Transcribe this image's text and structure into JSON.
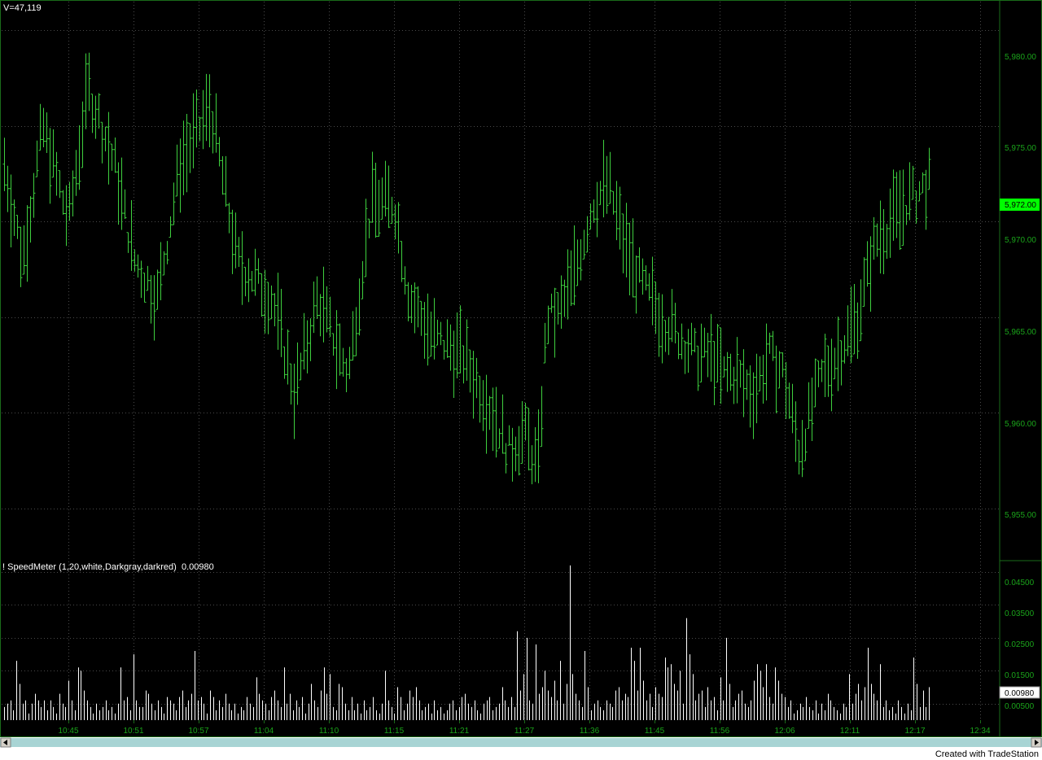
{
  "volume_label": "V=47,119",
  "footer_text": "Created with TradeStation",
  "colors": {
    "background": "#000000",
    "price_bars": "#3ecf3e",
    "speed_bars": "#ffffff",
    "grid": "#4a4a4a",
    "axis_text": "#1aa31a",
    "last_price_bg": "#00ff00",
    "scrollbar": "#a8d4d4"
  },
  "chart_data": [
    {
      "type": "ohlc",
      "title": "",
      "y_ticks": [
        "5,980.00",
        "5,975.00",
        "5,970.00",
        "5,965.00",
        "5,960.00",
        "5,955.00"
      ],
      "y_tick_values": [
        5980,
        5975,
        5970,
        5965,
        5960,
        5955
      ],
      "ylim": [
        5952.3,
        5981.5
      ],
      "last_price": 5972.0,
      "last_price_label": "5,972.00",
      "grid": true,
      "bar_count": 285,
      "path_times": [
        0,
        12,
        25,
        42,
        55,
        72,
        85,
        100,
        115,
        135,
        152,
        175,
        190,
        205,
        225,
        240,
        255,
        265,
        280
      ],
      "path_values": [
        5973,
        5968,
        5975,
        5970,
        5977,
        5973,
        5968,
        5966,
        5973,
        5976,
        5968,
        5966,
        5961,
        5966,
        5962,
        5971,
        5971,
        5966,
        5964
      ],
      "path_times_2": [
        300,
        320,
        330,
        340,
        349
      ],
      "path_values_2": [
        5963,
        5960,
        5958,
        5959,
        5957
      ],
      "path_times_3": [
        355,
        362,
        372,
        385,
        395,
        405,
        415,
        430,
        442,
        452,
        462,
        470,
        478,
        490,
        500,
        510,
        520,
        535,
        545,
        558,
        570,
        590,
        605
      ],
      "path_values_3": [
        5965,
        5965,
        5967,
        5971,
        5972,
        5969,
        5967,
        5965,
        5964,
        5963,
        5963,
        5962,
        5962,
        5961,
        5963,
        5962,
        5958,
        5962,
        5963,
        5965,
        5969,
        5971,
        5972
      ],
      "x_ticks": [
        "10:45",
        "10:51",
        "10:57",
        "11:04",
        "11:10",
        "11:15",
        "11:21",
        "11:27",
        "11:36",
        "11:45",
        "11:56",
        "12:06",
        "12:11",
        "12:17",
        "12:34"
      ]
    },
    {
      "type": "bar",
      "title": "! SpeedMeter (1,20,white,Darkgray,darkred)",
      "current_value": "0.00980",
      "y_ticks": [
        "0.04500",
        "0.03500",
        "0.02500",
        "0.01500",
        "0.00500"
      ],
      "y_tick_values": [
        0.045,
        0.035,
        0.025,
        0.015,
        0.005
      ],
      "ylim": [
        0,
        0.0482
      ],
      "grid": true,
      "series": [
        {
          "values": [
            0.004,
            0.005,
            0.006,
            0.003,
            0.018,
            0.011,
            0.005,
            0.006,
            0.002,
            0.005,
            0.008,
            0.006,
            0.004,
            0.006,
            0.003,
            0.006,
            0.004,
            0.002,
            0.008,
            0.005,
            0.004,
            0.012,
            0.006,
            0.003,
            0.016,
            0.015,
            0.009,
            0.006,
            0.004,
            0.002,
            0.005,
            0.003,
            0.004,
            0.006,
            0.003,
            0.004,
            0.002,
            0.005,
            0.016,
            0.006,
            0.007,
            0.003,
            0.02,
            0.006,
            0.004,
            0.004,
            0.009,
            0.008,
            0.005,
            0.003,
            0.006,
            0.004,
            0.002,
            0.007,
            0.006,
            0.005,
            0.003,
            0.007,
            0.009,
            0.004,
            0.006,
            0.008,
            0.021,
            0.006,
            0.007,
            0.005,
            0.002,
            0.009,
            0.007,
            0.003,
            0.006,
            0.004,
            0.008,
            0.005,
            0.003,
            0.005,
            0.002,
            0.004,
            0.003,
            0.007,
            0.005,
            0.004,
            0.013,
            0.008,
            0.006,
            0.005,
            0.003,
            0.007,
            0.009,
            0.006,
            0.004,
            0.016,
            0.005,
            0.008,
            0.003,
            0.006,
            0.004,
            0.007,
            0.002,
            0.005,
            0.011,
            0.006,
            0.004,
            0.009,
            0.016,
            0.008,
            0.014,
            0.004,
            0.003,
            0.011,
            0.01,
            0.005,
            0.003,
            0.007,
            0.003,
            0.005,
            0.002,
            0.006,
            0.003,
            0.004,
            0.007,
            0.003,
            0.002,
            0.005,
            0.015,
            0.006,
            0.004,
            0.002,
            0.01,
            0.007,
            0.003,
            0.005,
            0.009,
            0.007,
            0.01,
            0.006,
            0.003,
            0.004,
            0.005,
            0.002,
            0.006,
            0.003,
            0.004,
            0.002,
            0.003,
            0.005,
            0.006,
            0.003,
            0.004,
            0.007,
            0.008,
            0.005,
            0.004,
            0.006,
            0.003,
            0.002,
            0.005,
            0.006,
            0.007,
            0.003,
            0.004,
            0.005,
            0.01,
            0.006,
            0.004,
            0.007,
            0.004,
            0.027,
            0.009,
            0.014,
            0.025,
            0.006,
            0.005,
            0.023,
            0.008,
            0.01,
            0.015,
            0.009,
            0.007,
            0.012,
            0.006,
            0.018,
            0.005,
            0.011,
            0.047,
            0.014,
            0.008,
            0.006,
            0.004,
            0.021,
            0.01,
            0.003,
            0.005,
            0.006,
            0.004,
            0.003,
            0.006,
            0.005,
            0.004,
            0.009,
            0.01,
            0.006,
            0.008,
            0.007,
            0.022,
            0.018,
            0.009,
            0.022,
            0.012,
            0.006,
            0.008,
            0.004,
            0.01,
            0.008,
            0.007,
            0.019,
            0.016,
            0.017,
            0.011,
            0.009,
            0.015,
            0.005,
            0.031,
            0.02,
            0.014,
            0.006,
            0.008,
            0.009,
            0.004,
            0.01,
            0.006,
            0.007,
            0.003,
            0.013,
            0.006,
            0.025,
            0.011,
            0.004,
            0.006,
            0.008,
            0.009,
            0.005,
            0.004,
            0.006,
            0.012,
            0.017,
            0.015,
            0.01,
            0.017,
            0.007,
            0.005,
            0.016,
            0.012,
            0.008,
            0.007,
            0.004,
            0.006,
            0.002,
            0.003,
            0.005,
            0.004,
            0.007,
            0.004,
            0.003,
            0.006,
            0.002,
            0.005,
            0.003,
            0.008,
            0.006,
            0.004,
            0.003,
            0.002,
            0.005,
            0.004,
            0.014,
            0.005,
            0.008,
            0.011,
            0.006,
            0.01,
            0.022,
            0.011,
            0.008,
            0.006,
            0.017,
            0.004,
            0.006,
            0.003,
            0.004,
            0.002,
            0.006,
            0.004,
            0.002,
            0.005,
            0.003,
            0.019,
            0.011,
            0.004,
            0.009,
            0.004,
            0.01
          ]
        }
      ]
    }
  ]
}
